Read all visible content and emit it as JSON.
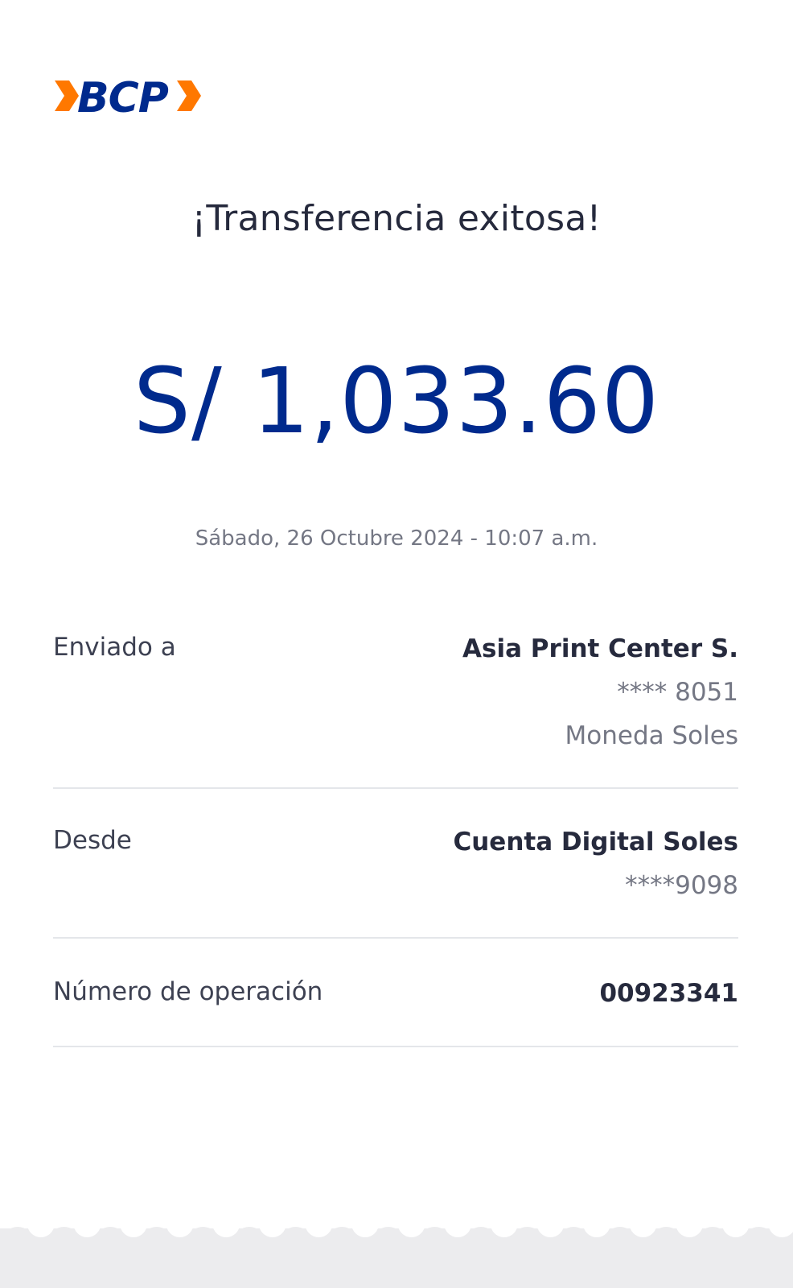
{
  "brand": {
    "logo_text": "BCP",
    "primary_color": "#002a8d",
    "accent_color": "#ff7800"
  },
  "receipt": {
    "title": "¡Transferencia exitosa!",
    "amount": "S/ 1,033.60",
    "datetime": "Sábado, 26 Octubre 2024 - 10:07 a.m."
  },
  "details": {
    "sent_to": {
      "label": "Enviado a",
      "name": "Asia Print Center S.",
      "account": "**** 8051",
      "currency": "Moneda Soles"
    },
    "from": {
      "label": "Desde",
      "account_name": "Cuenta Digital Soles",
      "account_number": "****9098"
    },
    "operation": {
      "label": "Número de operación",
      "number": "00923341"
    }
  }
}
